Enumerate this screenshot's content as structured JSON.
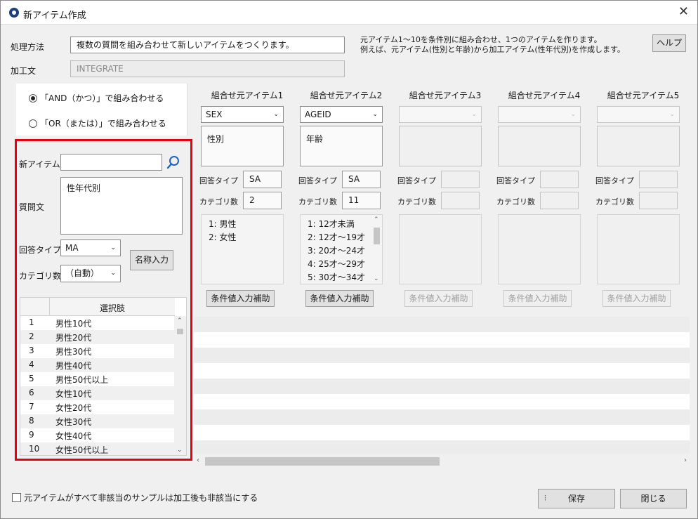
{
  "window": {
    "title": "新アイテム作成",
    "close_glyph": "✕"
  },
  "method": {
    "label": "処理方法",
    "value": "複数の質問を組み合わせて新しいアイテムをつくります。",
    "description_line1": "元アイテム1～10を条件別に組み合わせ、1つのアイテムを作ります。",
    "description_line2": "例えば、元アイテム(性別と年齢)から加工アイテム(性年代別)を作成します。",
    "help_label": "ヘルプ"
  },
  "processing": {
    "label": "加工文",
    "value": "INTEGRATE"
  },
  "mode": {
    "and_label": "「AND（かつ）」で組み合わせる",
    "or_label": "「OR（または）」で組み合わせる",
    "selected": "AND"
  },
  "new_item": {
    "name_label": "新アイテム",
    "name_value": "",
    "question_label": "質問文",
    "question_value": "性年代別",
    "answer_type_label": "回答タイプ",
    "answer_type_value": "MA",
    "category_count_label": "カテゴリ数",
    "category_count_value": "（自動）",
    "name_input_button": "名称入力"
  },
  "choices": {
    "header": "選択肢",
    "rows": [
      {
        "n": "1",
        "label": "男性10代"
      },
      {
        "n": "2",
        "label": "男性20代"
      },
      {
        "n": "3",
        "label": "男性30代"
      },
      {
        "n": "4",
        "label": "男性40代"
      },
      {
        "n": "5",
        "label": "男性50代以上"
      },
      {
        "n": "6",
        "label": "女性10代"
      },
      {
        "n": "7",
        "label": "女性20代"
      },
      {
        "n": "8",
        "label": "女性30代"
      },
      {
        "n": "9",
        "label": "女性40代"
      },
      {
        "n": "10",
        "label": "女性50代以上"
      }
    ]
  },
  "source_items": [
    {
      "title": "組合せ元アイテム1",
      "select": "SEX",
      "name": "性別",
      "answer_type": "SA",
      "category_count": "2",
      "categories": [
        "1: 男性",
        "2: 女性"
      ]
    },
    {
      "title": "組合せ元アイテム2",
      "select": "AGEID",
      "name": "年齢",
      "answer_type": "SA",
      "category_count": "11",
      "categories": [
        "1: 12才未満",
        "2: 12才～19才",
        "3: 20才～24才",
        "4: 25才～29才",
        "5: 30才～34才"
      ]
    },
    {
      "title": "組合せ元アイテム3",
      "select": "",
      "name": "",
      "answer_type": "",
      "category_count": "",
      "categories": []
    },
    {
      "title": "組合せ元アイテム4",
      "select": "",
      "name": "",
      "answer_type": "",
      "category_count": "",
      "categories": []
    },
    {
      "title": "組合せ元アイテム5",
      "select": "",
      "name": "",
      "answer_type": "",
      "category_count": "",
      "categories": []
    }
  ],
  "source_labels": {
    "answer_type": "回答タイプ",
    "category_count": "カテゴリ数",
    "condition_button": "条件値入力補助"
  },
  "footer": {
    "checkbox_label": "元アイテムがすべて非該当のサンプルは加工後も非該当にする",
    "save_label": "保存",
    "close_label": "閉じる"
  },
  "icons": {
    "search": "search-icon",
    "chevron": "chevron-down-icon",
    "app": "app-logo-icon"
  }
}
